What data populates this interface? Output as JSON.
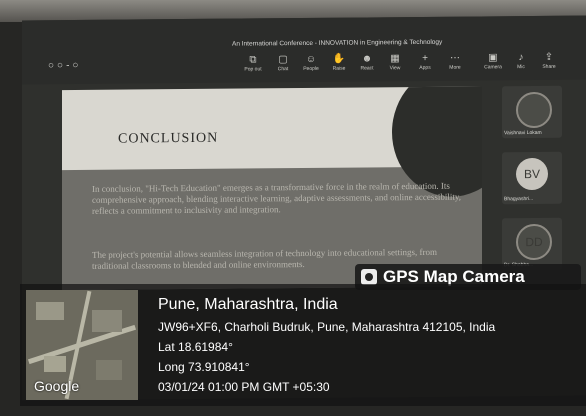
{
  "meeting": {
    "title": "An International Conference - INNOVATION in Engineering & Technology",
    "toolbar": [
      {
        "label": "Pop out",
        "icon": "pop-out-icon"
      },
      {
        "label": "Chat",
        "icon": "chat-icon"
      },
      {
        "label": "People",
        "icon": "people-icon"
      },
      {
        "label": "Raise",
        "icon": "raise-hand-icon"
      },
      {
        "label": "React",
        "icon": "react-icon"
      },
      {
        "label": "View",
        "icon": "view-icon"
      },
      {
        "label": "Apps",
        "icon": "apps-icon"
      },
      {
        "label": "More",
        "icon": "more-icon"
      },
      {
        "label": "Camera",
        "icon": "camera-icon"
      },
      {
        "label": "Mic",
        "icon": "mic-icon"
      },
      {
        "label": "Share",
        "icon": "share-icon"
      }
    ]
  },
  "slide": {
    "title": "CONCLUSION",
    "bullet1": "In conclusion, \"Hi-Tech Education\" emerges as a transformative force in the realm of education. Its comprehensive approach, blending interactive learning, adaptive assessments, and online accessibility, reflects a commitment to inclusivity and integration.",
    "bullet2": "The project's potential allows seamless integration of technology into educational settings, from traditional classrooms to blended and online environments."
  },
  "participants": [
    {
      "initials": "",
      "name": "Vaishnavi Lokam"
    },
    {
      "initials": "BV",
      "name": "Bhagyashri..."
    },
    {
      "initials": "DD",
      "name": "Dr. Shobha..."
    }
  ],
  "gps": {
    "badge": "GPS Map Camera",
    "city": "Pune, Maharashtra, India",
    "address": "JW96+XF6, Charholi Budruk, Pune, Maharashtra 412105, India",
    "lat": "Lat 18.61984°",
    "long": "Long 73.910841°",
    "datetime": "03/01/24 01:00 PM GMT +05:30",
    "map_brand": "Google"
  }
}
